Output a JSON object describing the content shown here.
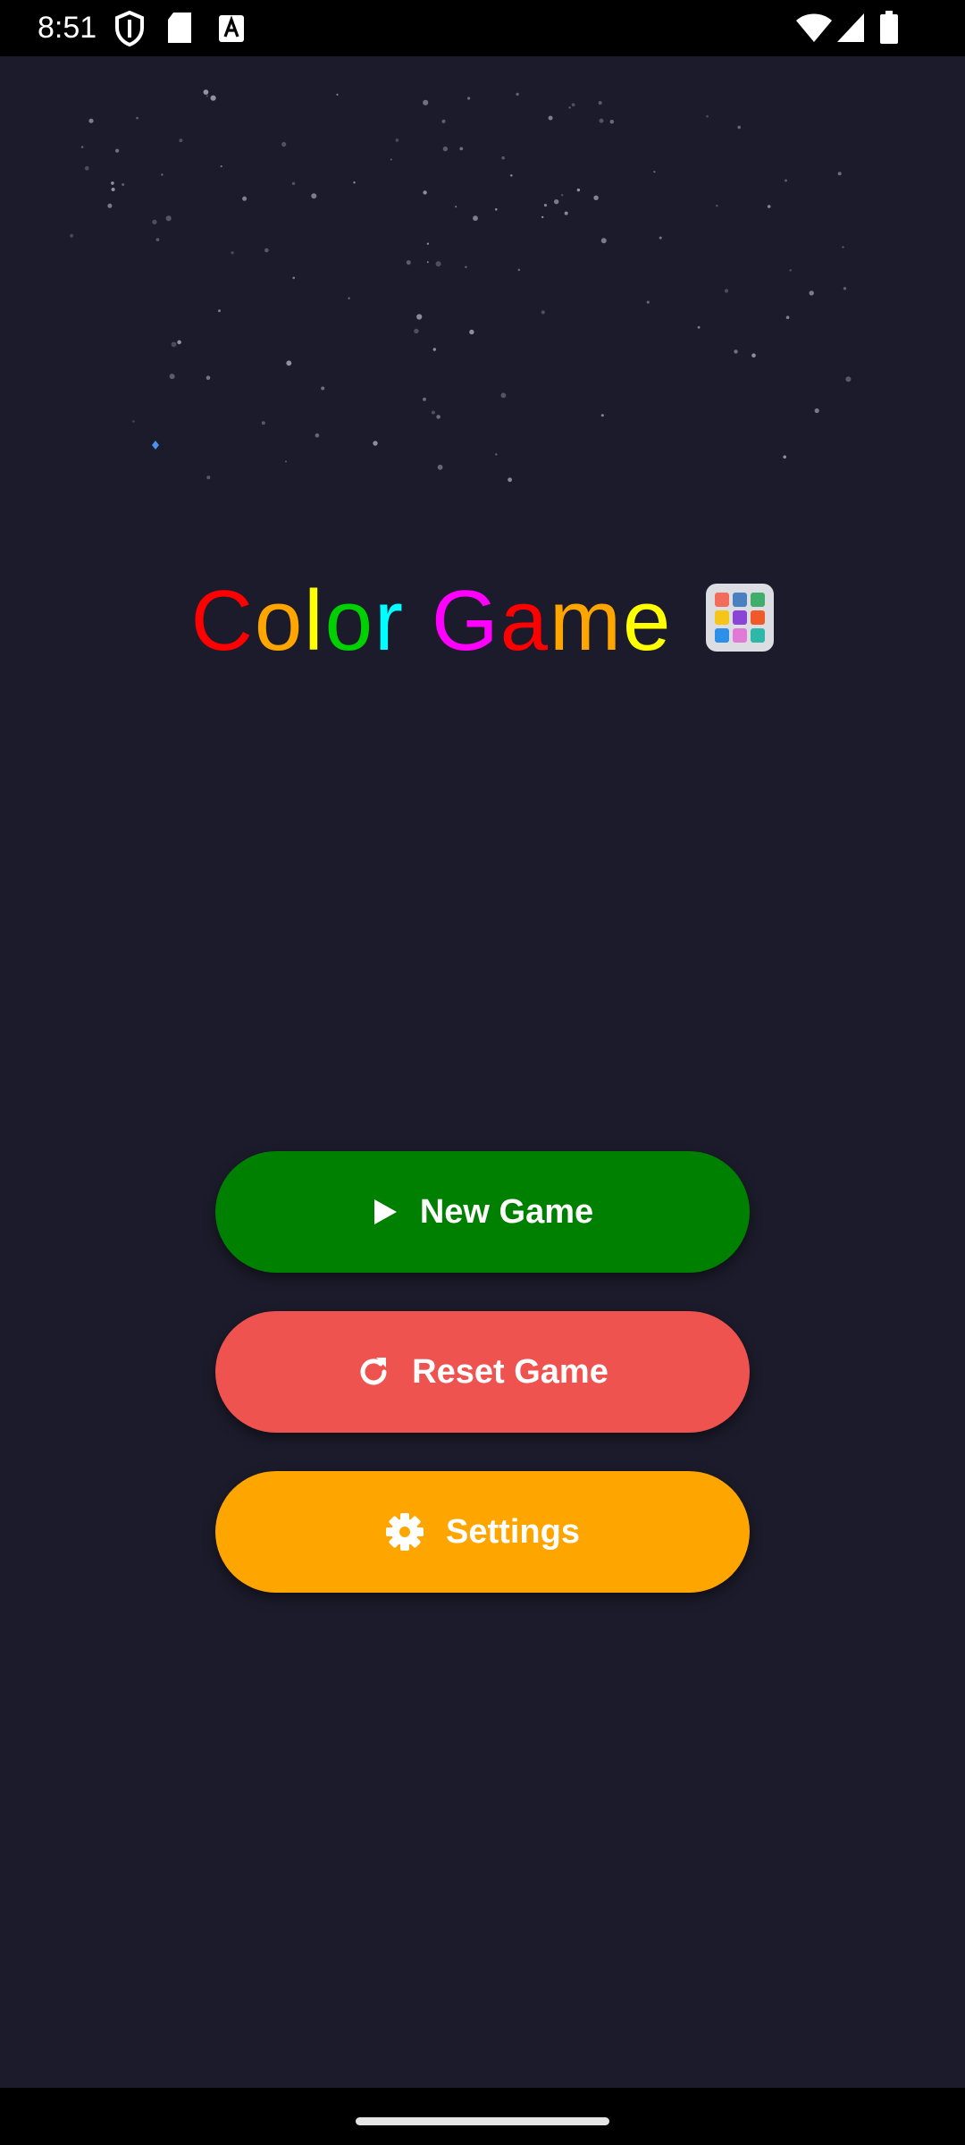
{
  "status_bar": {
    "time": "8:51",
    "left_icons": [
      "shield-icon",
      "sd-card-icon",
      "keyboard-a-icon"
    ],
    "right_icons": [
      "wifi-icon",
      "cellular-signal-icon",
      "battery-icon"
    ]
  },
  "title": {
    "letters": [
      {
        "char": "C",
        "color": "#ff0000"
      },
      {
        "char": "o",
        "color": "#ffa500"
      },
      {
        "char": "l",
        "color": "#ffff00"
      },
      {
        "char": "o",
        "color": "#00d000"
      },
      {
        "char": "r",
        "color": "#00ffff"
      },
      {
        "char": " ",
        "color": "#ffffff"
      },
      {
        "char": "G",
        "color": "#ff00ff"
      },
      {
        "char": "a",
        "color": "#ff0000"
      },
      {
        "char": "m",
        "color": "#ffa500"
      },
      {
        "char": "e",
        "color": "#ffff00"
      }
    ],
    "emoji_icon": "color-grid-icon"
  },
  "buttons": {
    "new_game": {
      "label": "New Game",
      "icon": "play-icon",
      "color": "#008000"
    },
    "reset_game": {
      "label": "Reset Game",
      "icon": "refresh-icon",
      "color": "#ef5350"
    },
    "settings": {
      "label": "Settings",
      "icon": "gear-icon",
      "color": "#ffa500"
    }
  },
  "colors": {
    "background": "#1c1b2b",
    "star": "#9a9aa8"
  }
}
